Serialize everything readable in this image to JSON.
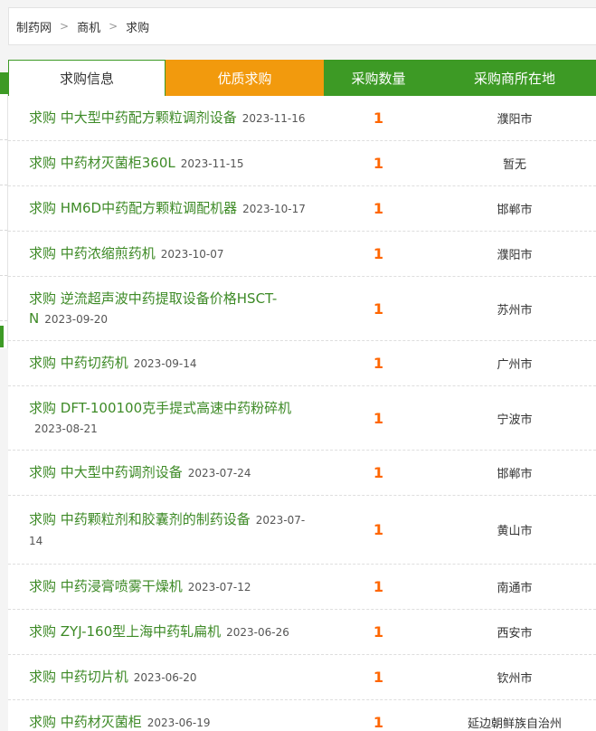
{
  "breadcrumb": {
    "items": [
      "制药网",
      "商机",
      "求购"
    ],
    "separator": ">"
  },
  "tabs": [
    {
      "label": "求购信息"
    },
    {
      "label": "优质求购"
    },
    {
      "label": "采购数量"
    },
    {
      "label": "采购商所在地"
    }
  ],
  "colors": {
    "green": "#3d9a25",
    "orange": "#f29a0d",
    "qty": "#ff6600",
    "link": "#3d8a26"
  },
  "rows": [
    {
      "title": "求购 中大型中药配方颗粒调剂设备",
      "date": "2023-11-16",
      "qty": "1",
      "location": "濮阳市"
    },
    {
      "title": "求购 中药材灭菌柜360L",
      "date": "2023-11-15",
      "qty": "1",
      "location": "暂无"
    },
    {
      "title": "求购 HM6D中药配方颗粒调配机器",
      "date": "2023-10-17",
      "qty": "1",
      "location": "邯郸市"
    },
    {
      "title": "求购 中药浓缩煎药机",
      "date": "2023-10-07",
      "qty": "1",
      "location": "濮阳市"
    },
    {
      "title": "求购 逆流超声波中药提取设备价格HSCT-N",
      "date": "2023-09-20",
      "qty": "1",
      "location": "苏州市"
    },
    {
      "title": "求购 中药切药机",
      "date": "2023-09-14",
      "qty": "1",
      "location": "广州市"
    },
    {
      "title": "求购 DFT-100100克手提式高速中药粉碎机",
      "date": "2023-08-21",
      "qty": "1",
      "location": "宁波市"
    },
    {
      "title": "求购 中大型中药调剂设备",
      "date": "2023-07-24",
      "qty": "1",
      "location": "邯郸市"
    },
    {
      "title": "求购 中药颗粒剂和胶囊剂的制药设备",
      "date": "2023-07-14",
      "qty": "1",
      "location": "黄山市"
    },
    {
      "title": "求购 中药浸膏喷雾干燥机",
      "date": "2023-07-12",
      "qty": "1",
      "location": "南通市"
    },
    {
      "title": "求购 ZYJ-160型上海中药轧扁机",
      "date": "2023-06-26",
      "qty": "1",
      "location": "西安市"
    },
    {
      "title": "求购 中药切片机",
      "date": "2023-06-20",
      "qty": "1",
      "location": "钦州市"
    },
    {
      "title": "求购 中药材灭菌柜",
      "date": "2023-06-19",
      "qty": "1",
      "location": "延边朝鲜族自治州"
    }
  ]
}
